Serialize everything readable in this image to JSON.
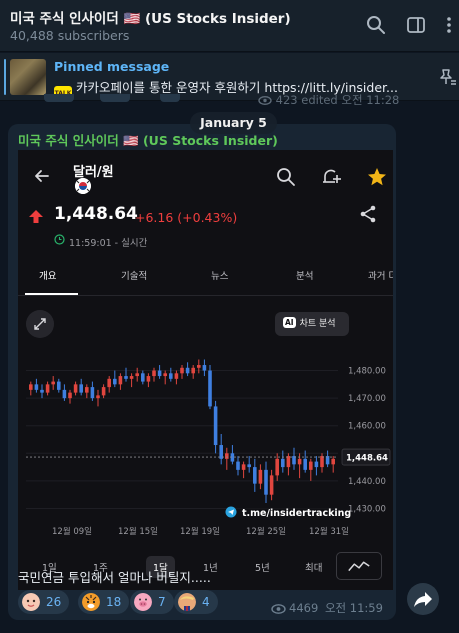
{
  "header": {
    "title": "미국 주식 인사이더 🇺🇸 (US Stocks Insider)",
    "subscribers": "40,488 subscribers",
    "icons": [
      "search-icon",
      "sidebar-toggle-icon",
      "more-icon"
    ]
  },
  "pinned": {
    "title": "Pinned message",
    "text": "카카오페이를 통한 운영자 후원하기  https://litt.ly/insider...",
    "kakao_badge": "TALK",
    "icon": "pin-list-icon"
  },
  "previous_message": {
    "views": "423",
    "meta": "edited 오전 11:28"
  },
  "date_chip": "January 5",
  "message": {
    "channel_name": "미국 주식 인사이더 🇺🇸 (US Stocks Insider)",
    "caption": "국민연금 투입해서 얼마나 버틸지.....",
    "views": "4469",
    "time": "오전 11:59",
    "reactions": [
      {
        "emoji": "baby-face",
        "count": "26"
      },
      {
        "emoji": "tiger-face",
        "count": "18"
      },
      {
        "emoji": "pig-face",
        "count": "7"
      },
      {
        "emoji": "trump-face",
        "count": "4"
      }
    ]
  },
  "app_screenshot": {
    "title": "달러/원",
    "price": "1,448.64",
    "change": "+6.16 (+0.43%)",
    "timestamp": "11:59:01 - 실시간",
    "tabs": [
      "개요",
      "기술적",
      "뉴스",
      "분석",
      "과거 더"
    ],
    "active_tab": "개요",
    "ai_button": "차트 분석",
    "ai_badge": "AI",
    "watermark": "t.me/insidertracking",
    "ranges": [
      "1일",
      "1주",
      "1달",
      "1년",
      "5년",
      "최대"
    ],
    "active_range": "1달",
    "colors": {
      "up": "#e0463f",
      "down": "#3f7fe0",
      "price": "#ef3e3e"
    }
  },
  "chart_data": {
    "type": "candlestick",
    "x_tick_labels": [
      "12월 09일",
      "12월 15일",
      "12월 19일",
      "12월 25일",
      "12월 31일"
    ],
    "y_tick_labels": [
      "1,480.00",
      "1,470.00",
      "1,460.00",
      "1,450.00",
      "1,440.00",
      "1,430.00"
    ],
    "ylim": [
      1428,
      1486
    ],
    "current_value_label": "1,448.64",
    "current_value": 1448.64,
    "up_color": "#e0463f",
    "down_color": "#3f7fe0",
    "candles": [
      [
        1473,
        1476,
        1471,
        1475
      ],
      [
        1475,
        1477,
        1472,
        1473
      ],
      [
        1473,
        1475,
        1470,
        1472
      ],
      [
        1472,
        1476,
        1471,
        1475
      ],
      [
        1475,
        1478,
        1473,
        1476
      ],
      [
        1476,
        1477,
        1472,
        1473
      ],
      [
        1473,
        1475,
        1469,
        1470
      ],
      [
        1470,
        1473,
        1468,
        1472
      ],
      [
        1472,
        1476,
        1471,
        1475
      ],
      [
        1475,
        1477,
        1471,
        1472
      ],
      [
        1472,
        1475,
        1470,
        1474
      ],
      [
        1474,
        1476,
        1469,
        1470
      ],
      [
        1470,
        1473,
        1467,
        1471
      ],
      [
        1471,
        1475,
        1470,
        1474
      ],
      [
        1474,
        1478,
        1472,
        1477
      ],
      [
        1477,
        1480,
        1474,
        1475
      ],
      [
        1475,
        1479,
        1473,
        1478
      ],
      [
        1478,
        1481,
        1476,
        1477
      ],
      [
        1477,
        1479,
        1474,
        1478
      ],
      [
        1478,
        1481,
        1476,
        1479
      ],
      [
        1479,
        1480,
        1475,
        1476
      ],
      [
        1476,
        1479,
        1474,
        1478
      ],
      [
        1478,
        1481,
        1476,
        1480
      ],
      [
        1480,
        1482,
        1477,
        1478
      ],
      [
        1478,
        1480,
        1475,
        1479
      ],
      [
        1479,
        1481,
        1476,
        1477
      ],
      [
        1477,
        1480,
        1475,
        1479
      ],
      [
        1479,
        1482,
        1477,
        1481
      ],
      [
        1481,
        1483,
        1478,
        1479
      ],
      [
        1479,
        1482,
        1477,
        1481
      ],
      [
        1481,
        1484,
        1479,
        1482
      ],
      [
        1482,
        1484,
        1478,
        1480
      ],
      [
        1480,
        1482,
        1466,
        1467
      ],
      [
        1467,
        1469,
        1450,
        1453
      ],
      [
        1453,
        1457,
        1446,
        1448
      ],
      [
        1448,
        1452,
        1444,
        1450
      ],
      [
        1450,
        1453,
        1446,
        1447
      ],
      [
        1447,
        1449,
        1442,
        1444
      ],
      [
        1444,
        1447,
        1441,
        1446
      ],
      [
        1446,
        1449,
        1443,
        1445
      ],
      [
        1445,
        1448,
        1436,
        1439
      ],
      [
        1439,
        1446,
        1437,
        1444
      ],
      [
        1444,
        1447,
        1432,
        1435
      ],
      [
        1435,
        1444,
        1433,
        1442
      ],
      [
        1442,
        1450,
        1440,
        1448
      ],
      [
        1448,
        1451,
        1443,
        1445
      ],
      [
        1445,
        1450,
        1442,
        1449
      ],
      [
        1449,
        1452,
        1444,
        1446
      ],
      [
        1446,
        1450,
        1441,
        1448
      ],
      [
        1448,
        1451,
        1443,
        1444
      ],
      [
        1444,
        1448,
        1440,
        1447
      ],
      [
        1447,
        1449,
        1442,
        1445
      ],
      [
        1445,
        1450,
        1443,
        1449
      ],
      [
        1449,
        1451,
        1445,
        1446
      ],
      [
        1446,
        1449,
        1443,
        1448
      ]
    ]
  }
}
